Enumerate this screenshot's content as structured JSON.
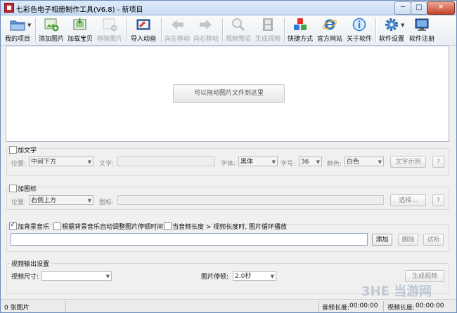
{
  "window": {
    "title": "七彩色电子相册制作工具(V6.8) - 新项目",
    "minimize_glyph": "─",
    "maximize_glyph": "□",
    "close_glyph": "✕"
  },
  "toolbar": {
    "items": [
      {
        "label": "我的项目",
        "icon": "folder-icon",
        "color": "#4a78c2",
        "enabled": true
      },
      {
        "label": "添加图片",
        "icon": "add-image-icon",
        "color": "#3f9b3a",
        "enabled": true
      },
      {
        "label": "加载宝贝",
        "icon": "load-package-icon",
        "color": "#3a8d3d",
        "enabled": true
      },
      {
        "label": "移除图片",
        "icon": "remove-image-icon",
        "color": "#777777",
        "enabled": false
      },
      {
        "label": "导入动画",
        "icon": "import-animation-icon",
        "color": "#d23b2a",
        "enabled": true
      },
      {
        "label": "向左移动",
        "icon": "arrow-left-icon",
        "color": "#6a6a6a",
        "enabled": false
      },
      {
        "label": "向右移动",
        "icon": "arrow-right-icon",
        "color": "#6a6a6a",
        "enabled": false
      },
      {
        "label": "视频预览",
        "icon": "magnifier-icon",
        "color": "#5a5a5a",
        "enabled": false
      },
      {
        "label": "生成视频",
        "icon": "film-icon",
        "color": "#333333",
        "enabled": false
      },
      {
        "label": "快捷方式",
        "icon": "shortcut-cubes-icon",
        "color": "#2f7fd0",
        "enabled": true
      },
      {
        "label": "官方网站",
        "icon": "ie-icon",
        "color": "#1f74cc",
        "enabled": true
      },
      {
        "label": "关于软件",
        "icon": "info-icon",
        "color": "#2a7bd6",
        "enabled": true
      },
      {
        "label": "软件设置",
        "icon": "gear-icon",
        "color": "#2a6db8",
        "enabled": true
      },
      {
        "label": "软件注册",
        "icon": "register-icon",
        "color": "#2e5fa6",
        "enabled": true
      }
    ]
  },
  "drop_area": {
    "hint": "可以拖动图片文件到这里"
  },
  "text_panel": {
    "checkbox_label": "加文字",
    "checked": false,
    "position_label": "位置:",
    "position_value": "中间下方",
    "text_label": "文字:",
    "font_label": "字体:",
    "font_value": "黑体",
    "size_label": "字号:",
    "size_value": "36",
    "color_label": "颜色:",
    "color_value": "白色",
    "sample_button": "文字示例",
    "help_button": "?"
  },
  "icon_panel": {
    "checkbox_label": "加图标",
    "checked": false,
    "position_label": "位置:",
    "position_value": "右侧上方",
    "icon_label": "图标:",
    "choose_button": "选择...",
    "help_button": "?"
  },
  "music_panel": {
    "bg_music_label": "加背景音乐",
    "bg_music_checked": true,
    "auto_adjust_label": "根据背景音乐自动调整图片停顿时间",
    "auto_adjust_checked": false,
    "loop_label": "当音频长度 > 视频长度时, 图片循环播放",
    "loop_checked": false,
    "add_button": "添加",
    "delete_button": "删除",
    "listen_button": "试听"
  },
  "output_panel": {
    "section_title": "视频输出设置",
    "size_label": "视频尺寸:",
    "size_value": "",
    "pause_label": "图片停顿:",
    "pause_value": "2.0秒",
    "generate_button": "生成视频"
  },
  "statusbar": {
    "image_count": "0 张图片",
    "audio_length_label": "音频长度:",
    "audio_length_value": "00:00:00",
    "video_length_label": "视频长度:",
    "video_length_value": "00:00:00"
  },
  "watermark": "3HE 当游网"
}
